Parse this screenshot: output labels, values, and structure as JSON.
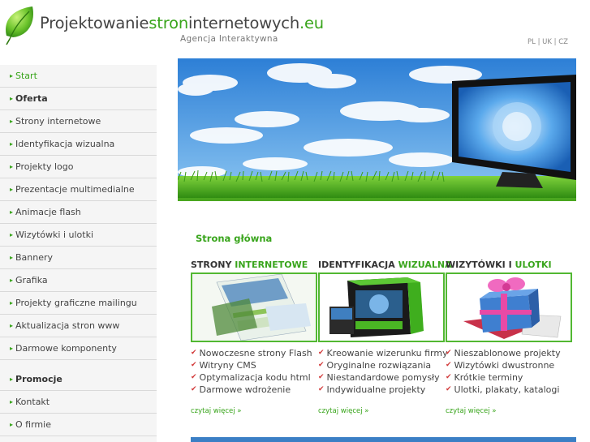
{
  "header": {
    "logo_part1": "Projektowanie",
    "logo_part2": "stron",
    "logo_part3": "internetowych",
    "logo_part4": ".eu",
    "slogan": "Agencja Interaktywna",
    "langs": [
      "PL",
      "UK",
      "CZ"
    ],
    "lang_sep": " | "
  },
  "sidebar": {
    "items": [
      {
        "label": "Start",
        "type": "active"
      },
      {
        "label": "Oferta",
        "type": "section"
      },
      {
        "label": "Strony internetowe",
        "type": "link"
      },
      {
        "label": "Identyfikacja wizualna",
        "type": "link"
      },
      {
        "label": "Projekty logo",
        "type": "link"
      },
      {
        "label": "Prezentacje multimedialne",
        "type": "link"
      },
      {
        "label": "Animacje flash",
        "type": "link"
      },
      {
        "label": "Wizytówki i ulotki",
        "type": "link"
      },
      {
        "label": "Bannery",
        "type": "link"
      },
      {
        "label": "Grafika",
        "type": "link"
      },
      {
        "label": "Projekty graficzne mailingu",
        "type": "link"
      },
      {
        "label": "Aktualizacja stron www",
        "type": "link"
      },
      {
        "label": "Darmowe komponenty",
        "type": "link"
      },
      {
        "label": "Promocje",
        "type": "section"
      },
      {
        "label": "Kontakt",
        "type": "link"
      },
      {
        "label": "O firmie",
        "type": "link"
      }
    ]
  },
  "main": {
    "title": "Strona główna",
    "columns": [
      {
        "head_a": "STRONY ",
        "head_b": "INTERNETOWE",
        "items": [
          "Nowoczesne strony Flash",
          "Witryny CMS",
          "Optymalizacja kodu html",
          "Darmowe wdrożenie"
        ],
        "more": "czytaj więcej »"
      },
      {
        "head_a": "IDENTYFIKACJA ",
        "head_b": "WIZUALNA",
        "items": [
          "Kreowanie wizerunku firmy",
          "Oryginalne rozwiązania",
          "Niestandardowe pomysły",
          "Indywidualne projekty"
        ],
        "more": "czytaj więcej »"
      },
      {
        "head_a": "WIZYTÓWKI I ",
        "head_b": "ULOTKI",
        "items": [
          "Nieszablonowe projekty",
          "Wizytówki dwustronne",
          "Krótkie terminy",
          "Ulotki, plakaty, katalogi"
        ],
        "more": "czytaj więcej »"
      }
    ]
  },
  "colors": {
    "accent_green": "#39a51c",
    "check_red": "#d23a3a",
    "sidebar_bg": "#f5f5f5"
  },
  "icons": {
    "logo": "leaf-icon",
    "bullet": "triangle-bullet-icon",
    "check": "checkmark-icon"
  }
}
